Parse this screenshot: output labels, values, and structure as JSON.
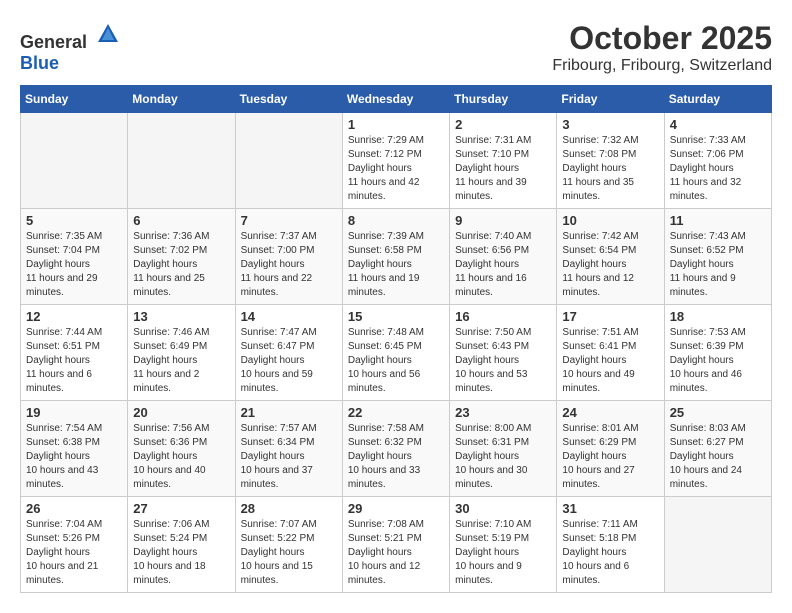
{
  "header": {
    "logo_general": "General",
    "logo_blue": "Blue",
    "month": "October 2025",
    "location": "Fribourg, Fribourg, Switzerland"
  },
  "days_of_week": [
    "Sunday",
    "Monday",
    "Tuesday",
    "Wednesday",
    "Thursday",
    "Friday",
    "Saturday"
  ],
  "weeks": [
    [
      {
        "day": "",
        "empty": true
      },
      {
        "day": "",
        "empty": true
      },
      {
        "day": "",
        "empty": true
      },
      {
        "day": "1",
        "sunrise": "7:29 AM",
        "sunset": "7:12 PM",
        "daylight": "11 hours and 42 minutes."
      },
      {
        "day": "2",
        "sunrise": "7:31 AM",
        "sunset": "7:10 PM",
        "daylight": "11 hours and 39 minutes."
      },
      {
        "day": "3",
        "sunrise": "7:32 AM",
        "sunset": "7:08 PM",
        "daylight": "11 hours and 35 minutes."
      },
      {
        "day": "4",
        "sunrise": "7:33 AM",
        "sunset": "7:06 PM",
        "daylight": "11 hours and 32 minutes."
      }
    ],
    [
      {
        "day": "5",
        "sunrise": "7:35 AM",
        "sunset": "7:04 PM",
        "daylight": "11 hours and 29 minutes."
      },
      {
        "day": "6",
        "sunrise": "7:36 AM",
        "sunset": "7:02 PM",
        "daylight": "11 hours and 25 minutes."
      },
      {
        "day": "7",
        "sunrise": "7:37 AM",
        "sunset": "7:00 PM",
        "daylight": "11 hours and 22 minutes."
      },
      {
        "day": "8",
        "sunrise": "7:39 AM",
        "sunset": "6:58 PM",
        "daylight": "11 hours and 19 minutes."
      },
      {
        "day": "9",
        "sunrise": "7:40 AM",
        "sunset": "6:56 PM",
        "daylight": "11 hours and 16 minutes."
      },
      {
        "day": "10",
        "sunrise": "7:42 AM",
        "sunset": "6:54 PM",
        "daylight": "11 hours and 12 minutes."
      },
      {
        "day": "11",
        "sunrise": "7:43 AM",
        "sunset": "6:52 PM",
        "daylight": "11 hours and 9 minutes."
      }
    ],
    [
      {
        "day": "12",
        "sunrise": "7:44 AM",
        "sunset": "6:51 PM",
        "daylight": "11 hours and 6 minutes."
      },
      {
        "day": "13",
        "sunrise": "7:46 AM",
        "sunset": "6:49 PM",
        "daylight": "11 hours and 2 minutes."
      },
      {
        "day": "14",
        "sunrise": "7:47 AM",
        "sunset": "6:47 PM",
        "daylight": "10 hours and 59 minutes."
      },
      {
        "day": "15",
        "sunrise": "7:48 AM",
        "sunset": "6:45 PM",
        "daylight": "10 hours and 56 minutes."
      },
      {
        "day": "16",
        "sunrise": "7:50 AM",
        "sunset": "6:43 PM",
        "daylight": "10 hours and 53 minutes."
      },
      {
        "day": "17",
        "sunrise": "7:51 AM",
        "sunset": "6:41 PM",
        "daylight": "10 hours and 49 minutes."
      },
      {
        "day": "18",
        "sunrise": "7:53 AM",
        "sunset": "6:39 PM",
        "daylight": "10 hours and 46 minutes."
      }
    ],
    [
      {
        "day": "19",
        "sunrise": "7:54 AM",
        "sunset": "6:38 PM",
        "daylight": "10 hours and 43 minutes."
      },
      {
        "day": "20",
        "sunrise": "7:56 AM",
        "sunset": "6:36 PM",
        "daylight": "10 hours and 40 minutes."
      },
      {
        "day": "21",
        "sunrise": "7:57 AM",
        "sunset": "6:34 PM",
        "daylight": "10 hours and 37 minutes."
      },
      {
        "day": "22",
        "sunrise": "7:58 AM",
        "sunset": "6:32 PM",
        "daylight": "10 hours and 33 minutes."
      },
      {
        "day": "23",
        "sunrise": "8:00 AM",
        "sunset": "6:31 PM",
        "daylight": "10 hours and 30 minutes."
      },
      {
        "day": "24",
        "sunrise": "8:01 AM",
        "sunset": "6:29 PM",
        "daylight": "10 hours and 27 minutes."
      },
      {
        "day": "25",
        "sunrise": "8:03 AM",
        "sunset": "6:27 PM",
        "daylight": "10 hours and 24 minutes."
      }
    ],
    [
      {
        "day": "26",
        "sunrise": "7:04 AM",
        "sunset": "5:26 PM",
        "daylight": "10 hours and 21 minutes."
      },
      {
        "day": "27",
        "sunrise": "7:06 AM",
        "sunset": "5:24 PM",
        "daylight": "10 hours and 18 minutes."
      },
      {
        "day": "28",
        "sunrise": "7:07 AM",
        "sunset": "5:22 PM",
        "daylight": "10 hours and 15 minutes."
      },
      {
        "day": "29",
        "sunrise": "7:08 AM",
        "sunset": "5:21 PM",
        "daylight": "10 hours and 12 minutes."
      },
      {
        "day": "30",
        "sunrise": "7:10 AM",
        "sunset": "5:19 PM",
        "daylight": "10 hours and 9 minutes."
      },
      {
        "day": "31",
        "sunrise": "7:11 AM",
        "sunset": "5:18 PM",
        "daylight": "10 hours and 6 minutes."
      },
      {
        "day": "",
        "empty": true
      }
    ]
  ]
}
